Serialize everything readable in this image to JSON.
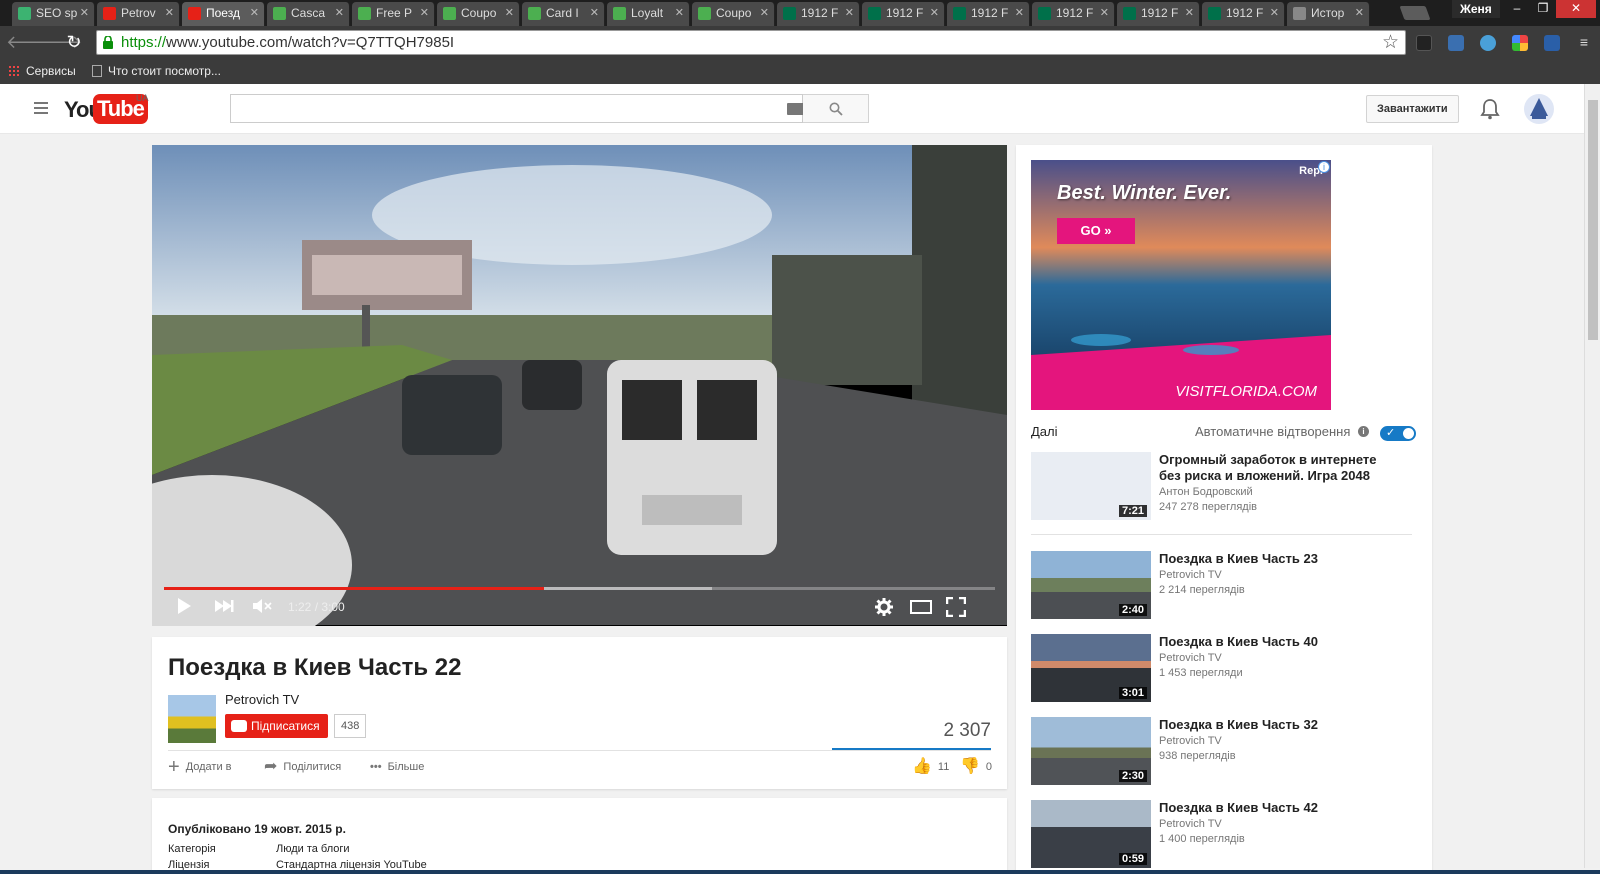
{
  "browser": {
    "tabs": [
      {
        "label": "SEO sp",
        "color": "#3cb371"
      },
      {
        "label": "Petrov",
        "color": "#e62117"
      },
      {
        "label": "Поезд",
        "color": "#e62117"
      },
      {
        "label": "Casca",
        "color": "#4caf50"
      },
      {
        "label": "Free P",
        "color": "#4caf50"
      },
      {
        "label": "Coupo",
        "color": "#4caf50"
      },
      {
        "label": "Card I",
        "color": "#4caf50"
      },
      {
        "label": "Loyalt",
        "color": "#4caf50"
      },
      {
        "label": "Coupo",
        "color": "#4caf50"
      },
      {
        "label": "1912 F",
        "color": "#00704a"
      },
      {
        "label": "1912 F",
        "color": "#00704a"
      },
      {
        "label": "1912 F",
        "color": "#00704a"
      },
      {
        "label": "1912 F",
        "color": "#00704a"
      },
      {
        "label": "1912 F",
        "color": "#00704a"
      },
      {
        "label": "1912 F",
        "color": "#00704a"
      },
      {
        "label": "Истор",
        "color": "#888888"
      }
    ],
    "active_tab": 2,
    "user": "Женя",
    "url_green": "https://",
    "url_rest": "www.youtube.com/watch?v=Q7TTQH7985I",
    "bookmarks": [
      "Сервисы",
      "Что стоит посмотр..."
    ]
  },
  "youtube": {
    "region": "UA",
    "logo_you": "You",
    "logo_tube": "Tube",
    "upload_label": "Завантажити"
  },
  "player": {
    "time": "1:22 / 3:00",
    "progress": 0.457,
    "buffered": 0.66
  },
  "video": {
    "title": "Поездка в Киев Часть 22",
    "channel": "Petrovich TV",
    "subscribe_label": "Підписатися",
    "subscribers": "438",
    "views": "2 307",
    "actions": {
      "add": "Додати в",
      "share": "Поділитися",
      "more": "Більше"
    },
    "likes": "11",
    "dislikes": "0"
  },
  "details": {
    "published": "Опубліковано 19 жовт. 2015 р.",
    "rows": [
      {
        "key": "Категорія",
        "value": "Люди та блоги"
      },
      {
        "key": "Ліцензія",
        "value": "Стандартна ліцензія YouTube"
      }
    ]
  },
  "ad": {
    "headline": "Best. Winter. Ever.",
    "cta": "GO »",
    "brand": "VISITFLORIDA.COM",
    "corner": "Repl",
    "info": "i"
  },
  "sidebar": {
    "next_label": "Далі",
    "autoplay_label": "Автоматичне відтворення",
    "autoplay_on": true,
    "videos": [
      {
        "title": "Огромный заработок в интернете без риска и вложений. Игра 2048",
        "channel": "Антон Бодровский",
        "views": "247 278 переглядів",
        "duration": "7:21"
      },
      {
        "title": "Поездка в Киев Часть 23",
        "channel": "Petrovich TV",
        "views": "2 214 переглядів",
        "duration": "2:40"
      },
      {
        "title": "Поездка в Киев Часть 40",
        "channel": "Petrovich TV",
        "views": "1 453 перегляди",
        "duration": "3:01"
      },
      {
        "title": "Поездка в Киев Часть 32",
        "channel": "Petrovich TV",
        "views": "938 переглядів",
        "duration": "2:30"
      },
      {
        "title": "Поездка в Киев Часть 42",
        "channel": "Petrovich TV",
        "views": "1 400 переглядів",
        "duration": "0:59"
      }
    ]
  },
  "colors": {
    "brand_red": "#e62117",
    "accent_blue": "#167ac6",
    "ad_pink": "#e4157d"
  }
}
